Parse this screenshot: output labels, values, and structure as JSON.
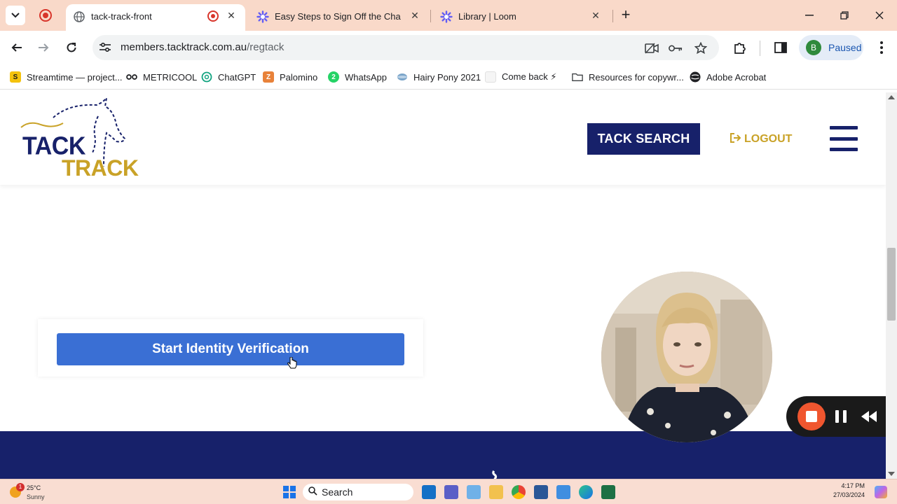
{
  "browser": {
    "tabs": [
      {
        "title": "tack-track-front",
        "active": true,
        "recording": true
      },
      {
        "title": "Easy Steps to Sign Off the Chapter",
        "active": false
      },
      {
        "title": "Library | Loom",
        "active": false
      }
    ],
    "address": {
      "host": "members.tacktrack.com.au",
      "path": "/regtack"
    },
    "profile": {
      "initial": "B",
      "status": "Paused"
    },
    "bookmarks": [
      {
        "label": "Streamtime — project...",
        "icon": "streamtime-icon"
      },
      {
        "label": "METRICOOL",
        "icon": "metricool-icon"
      },
      {
        "label": "ChatGPT",
        "icon": "chatgpt-icon"
      },
      {
        "label": "Palomino",
        "icon": "palomino-icon"
      },
      {
        "label": "WhatsApp",
        "icon": "whatsapp-icon"
      },
      {
        "label": "Hairy Pony 2021",
        "icon": "globe-icon"
      },
      {
        "label": "Come back ⚡",
        "icon": "page-icon"
      },
      {
        "label": "Resources for copywr...",
        "icon": "folder-icon"
      },
      {
        "label": "Adobe Acrobat",
        "icon": "globe-icon"
      }
    ]
  },
  "site": {
    "logo": {
      "line1": "TACK",
      "line2": "TRACK"
    },
    "nav": {
      "search_label": "TACK SEARCH",
      "logout_label": "LOGOUT"
    },
    "verify_button": "Start Identity Verification"
  },
  "taskbar": {
    "weather": {
      "temp": "25°C",
      "condition": "Sunny",
      "alerts": "1"
    },
    "search_label": "Search",
    "time": "4:17 PM",
    "date": "27/03/2024"
  },
  "colors": {
    "brand_navy": "#17216a",
    "brand_gold": "#c9a227",
    "verify_blue": "#3a6fd4",
    "loom_stop": "#f0562f"
  }
}
